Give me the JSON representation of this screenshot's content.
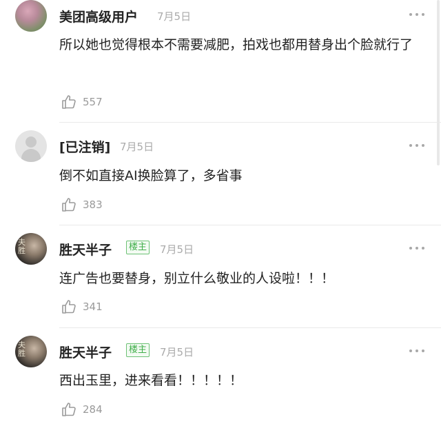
{
  "comments": [
    {
      "username": "美团高级用户",
      "date": "7月5日",
      "badge": "",
      "text": "所以她也觉得根本不需要减肥，拍戏也都用替身出个脸就行了",
      "likes": "557",
      "avatar_icon": "flower-avatar"
    },
    {
      "username": "[已注销]",
      "date": "7月5日",
      "badge": "",
      "text": "倒不如直接AI换脸算了，多省事",
      "likes": "383",
      "avatar_icon": "default-avatar"
    },
    {
      "username": "胜天半子",
      "date": "7月5日",
      "badge": "楼主",
      "text": "连广告也要替身，别立什么敬业的人设啦！！！",
      "likes": "341",
      "avatar_icon": "person-avatar"
    },
    {
      "username": "胜天半子",
      "date": "7月5日",
      "badge": "楼主",
      "text": "西出玉里，进来看看！！！！！",
      "likes": "284",
      "avatar_icon": "person-avatar"
    }
  ],
  "colors": {
    "badge_green": "#3fae49",
    "muted": "#aaaaaa",
    "divider": "#e9e9e9"
  }
}
